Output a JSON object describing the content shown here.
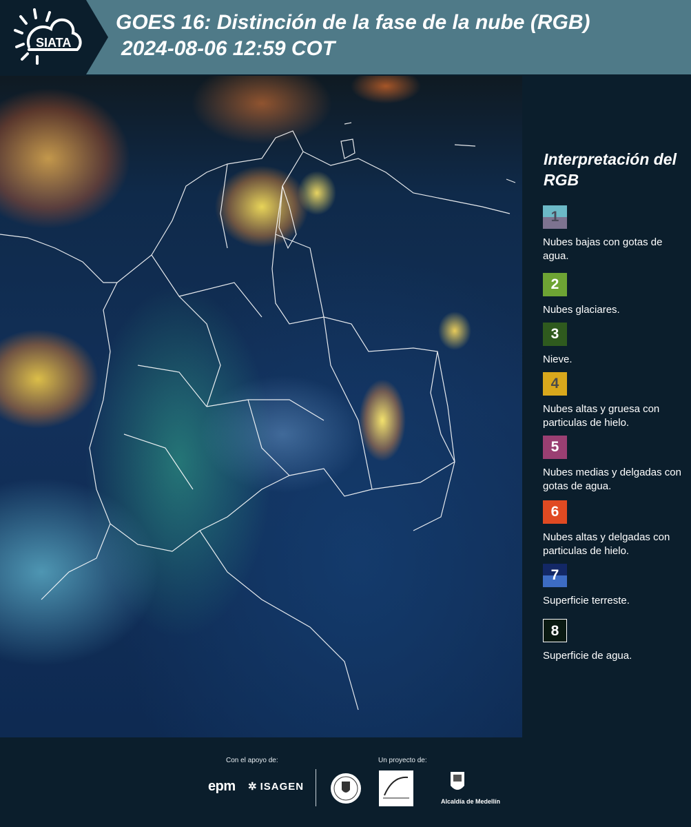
{
  "header": {
    "logo_text": "SIATA",
    "title": "GOES 16: Distinción de la fase de la nube (RGB)",
    "subtitle": "2024-08-06 12:59 COT"
  },
  "legend": {
    "title": "Interpretación del RGB",
    "items": [
      {
        "number": "1",
        "label": "Nubes bajas con gotas de agua.",
        "color_top": "#6cb9c7",
        "color_bottom": "#7d7390",
        "text_color": "#4a4a5a"
      },
      {
        "number": "2",
        "label": "Nubes glaciares.",
        "color_top": "#6ea434",
        "color_bottom": "#6ea434",
        "text_color": "#ffffff"
      },
      {
        "number": "3",
        "label": "Nieve.",
        "color_top": "#2f5a1e",
        "color_bottom": "#2f5a1e",
        "text_color": "#ffffff"
      },
      {
        "number": "4",
        "label": "Nubes altas y gruesa con particulas de hielo.",
        "color_top": "#d9a81c",
        "color_bottom": "#d9a81c",
        "text_color": "#4a4a4a"
      },
      {
        "number": "5",
        "label": "Nubes medias y delgadas con gotas de agua.",
        "color_top": "#9a3f72",
        "color_bottom": "#9a3f72",
        "text_color": "#ffffff"
      },
      {
        "number": "6",
        "label": "Nubes altas y delgadas con particulas de hielo.",
        "color_top": "#e04a22",
        "color_bottom": "#e04a22",
        "text_color": "#ffffff"
      },
      {
        "number": "7",
        "label": "Superficie terreste.",
        "color_top": "#132866",
        "color_bottom": "#3d6cc4",
        "text_color": "#ffffff"
      },
      {
        "number": "8",
        "label": "Superficie de agua.",
        "color_top": "#0a1a12",
        "color_bottom": "#0a1a12",
        "text_color": "#ffffff"
      }
    ]
  },
  "footer": {
    "support_label": "Con el apoyo de:",
    "project_label": "Un proyecto de:",
    "epm": "epm",
    "isagen": "ISAGEN",
    "alcaldia": "Alcaldía de Medellín"
  }
}
